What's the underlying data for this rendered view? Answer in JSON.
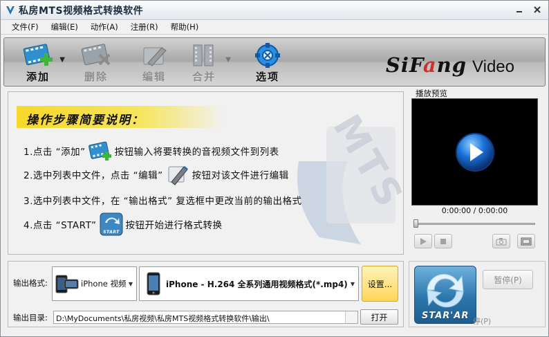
{
  "window": {
    "title": "私房MTS视频格式转换软件"
  },
  "menu": [
    {
      "label": "文件(F)"
    },
    {
      "label": "编辑(E)"
    },
    {
      "label": "动作(A)"
    },
    {
      "label": "注册(R)"
    },
    {
      "label": "帮助(H)"
    }
  ],
  "toolbar": {
    "add": "添加",
    "delete": "删除",
    "edit": "编辑",
    "merge": "合并",
    "options": "选项",
    "brand": "SiFang",
    "brand_accent_letter": "a",
    "brand_suffix": "Video"
  },
  "guide": {
    "title": "操作步骤简要说明：",
    "watermark": "MTS",
    "steps": [
      {
        "pre": "1.点击 “添加”",
        "post": "按钮输入将要转换的音视频文件到列表"
      },
      {
        "pre": "2.选中列表中文件，点击 “编辑”",
        "post": "按钮对该文件进行编辑"
      },
      {
        "pre": "3.选中列表中文件，在 “输出格式” 复选框中更改当前的输出格式",
        "post": ""
      },
      {
        "pre": "4.点击 “START”",
        "post": "按钮开始进行格式转换"
      }
    ],
    "start_icon_text": "START"
  },
  "preview": {
    "label": "播放预览",
    "time": "0:00:00 / 0:00:00",
    "progress": 0
  },
  "output": {
    "format_label": "输出格式:",
    "device": "iPhone 视频",
    "format": "iPhone - H.264 全系列通用视频格式(*.mp4)",
    "settings_button": "设置...",
    "dir_label": "输出目录:",
    "dir_path": "D:\\MyDocuments\\私房视频\\私房MTS视频格式转换软件\\输出\\",
    "open_button": "打开"
  },
  "controls": {
    "start": "STAR'AR",
    "pause": "暂停(P)",
    "stop_fragment": "停(P)"
  },
  "colors": {
    "guide_title_bg": "#f7d82a",
    "brand_accent": "#d0302c",
    "start_blue": "#2d77ad"
  }
}
